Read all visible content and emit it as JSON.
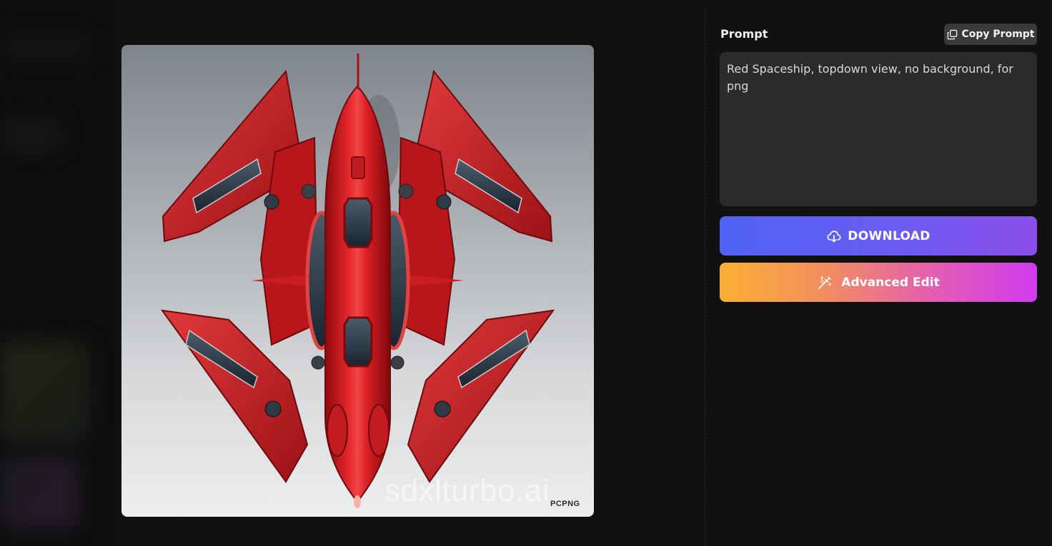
{
  "image": {
    "alt_subject": "red-spaceship-topdown",
    "watermark": "sdxlturbo.ai",
    "corner_mark": "PCPNG"
  },
  "panel": {
    "prompt_label": "Prompt",
    "copy_button_label": "Copy Prompt",
    "prompt_text": "Red Spaceship, topdown view, no background, for png",
    "download_label": "DOWNLOAD",
    "advanced_edit_label": "Advanced Edit"
  },
  "icons": {
    "copy": "copy-icon",
    "download": "cloud-download-icon",
    "edit": "magic-wand-icon"
  },
  "colors": {
    "background": "#111112",
    "prompt_box": "#2b2b2d",
    "copy_button": "#3a3a3c",
    "download_gradient": [
      "#4f63f5",
      "#8c4de9"
    ],
    "edit_gradient": [
      "#fbb033",
      "#cf3bef"
    ]
  }
}
